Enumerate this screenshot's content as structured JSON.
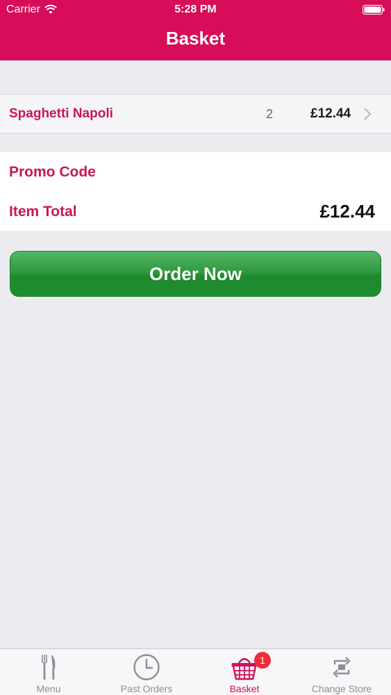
{
  "status_bar": {
    "carrier": "Carrier",
    "time": "5:28 PM"
  },
  "header": {
    "title": "Basket",
    "background_color": "#d70d59"
  },
  "basket": {
    "items": [
      {
        "name": "Spaghetti Napoli",
        "quantity": "2",
        "price": "£12.44"
      }
    ]
  },
  "summary": {
    "promo_label": "Promo Code",
    "total_label": "Item Total",
    "total_value": "£12.44"
  },
  "order_button": {
    "label": "Order Now",
    "color": "#2f9a3f"
  },
  "tab_bar": {
    "tabs": [
      {
        "label": "Menu",
        "icon": "fork-knife-icon"
      },
      {
        "label": "Past Orders",
        "icon": "clock-icon"
      },
      {
        "label": "Basket",
        "icon": "basket-icon",
        "active": true,
        "badge": "1"
      },
      {
        "label": "Change Store",
        "icon": "swap-arrows-icon"
      }
    ],
    "active_color": "#d70d59",
    "badge_color": "#ef2b3c"
  }
}
